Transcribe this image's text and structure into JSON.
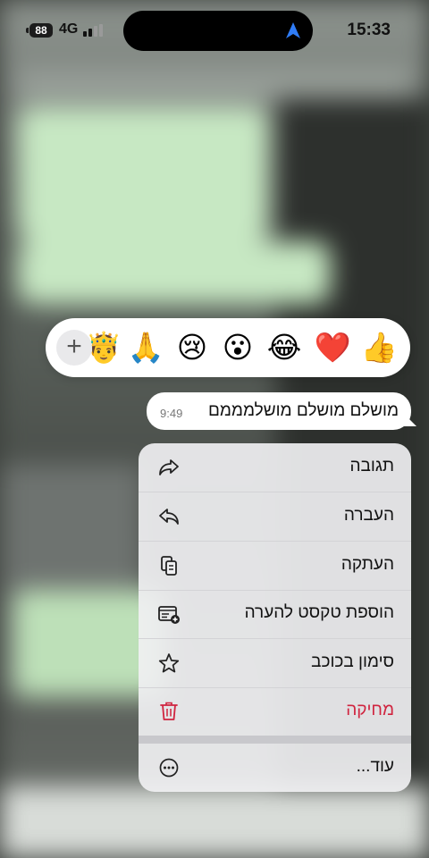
{
  "status_bar": {
    "battery": "88",
    "network": "4G",
    "time": "15:33"
  },
  "reaction_bar": {
    "add_symbol": "+",
    "emojis": [
      "👍",
      "❤️",
      "😂",
      "😮",
      "😢",
      "🙏",
      "🤴"
    ]
  },
  "message": {
    "text": "מושלם מושלם מושלמממם",
    "time": "9:49"
  },
  "menu": {
    "items": [
      {
        "label": "תגובה",
        "icon": "reply-icon"
      },
      {
        "label": "העברה",
        "icon": "forward-icon"
      },
      {
        "label": "העתקה",
        "icon": "copy-icon"
      },
      {
        "label": "הוספת טקסט להערה",
        "icon": "add-note-icon"
      },
      {
        "label": "סימון בכוכב",
        "icon": "star-icon"
      },
      {
        "label": "מחיקה",
        "icon": "trash-icon"
      },
      {
        "label": "עוד...",
        "icon": "more-icon"
      }
    ],
    "danger_color": "#d0243f"
  },
  "colors": {
    "accent_blue": "#2f7cf6",
    "bubble_bg": "#ffffff"
  }
}
